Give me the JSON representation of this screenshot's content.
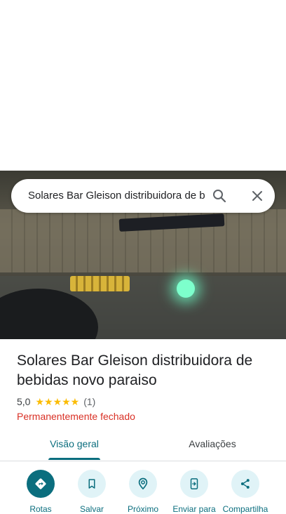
{
  "search": {
    "query": "Solares Bar Gleison distribuidora de bebidas novo paraiso"
  },
  "place": {
    "title": "Solares Bar Gleison distribuidora de bebidas novo paraiso",
    "rating": "5,0",
    "stars": "★★★★★",
    "review_count": "(1)",
    "status": "Permanentemente fechado"
  },
  "tabs": [
    {
      "label": "Visão geral",
      "selected": true
    },
    {
      "label": "Avaliações",
      "selected": false
    }
  ],
  "actions": [
    {
      "label": "Rotas",
      "icon": "directions-icon"
    },
    {
      "label": "Salvar",
      "icon": "bookmark-icon"
    },
    {
      "label": "Próximo",
      "icon": "nearby-icon"
    },
    {
      "label": "Enviar para",
      "icon": "send-to-phone-icon"
    },
    {
      "label": "Compartilha",
      "icon": "share-icon"
    }
  ],
  "colors": {
    "accent": "#0b6e7e",
    "accent_light": "#e0f3f7",
    "closed_status": "#d93025",
    "star": "#fbbc04"
  }
}
